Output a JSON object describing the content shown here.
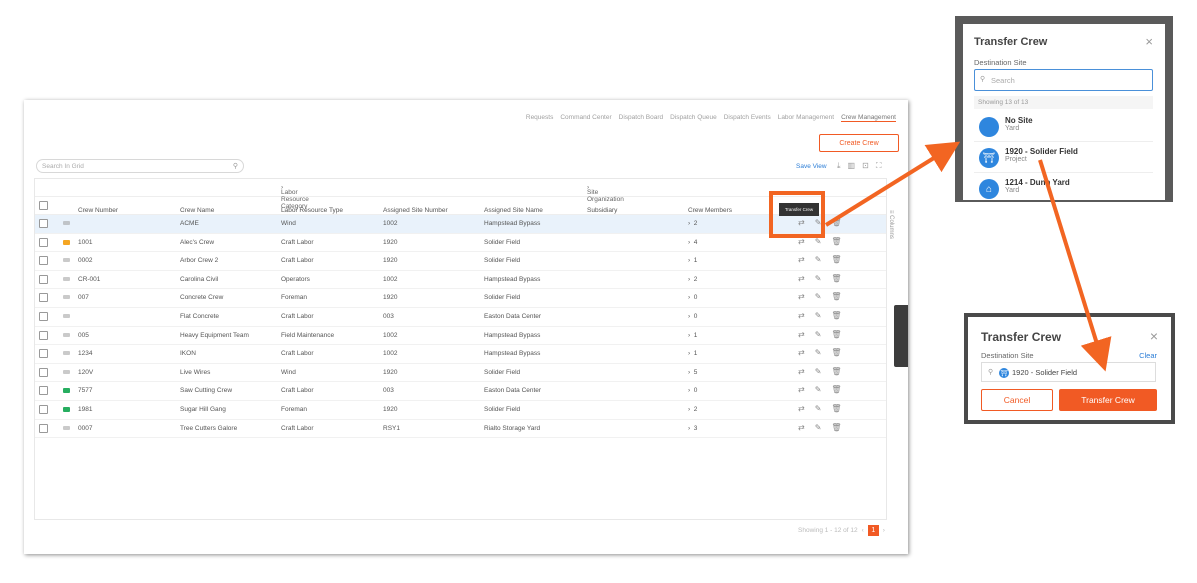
{
  "nav": {
    "items": [
      "Requests",
      "Command Center",
      "Dispatch Board",
      "Dispatch Queue",
      "Dispatch Events",
      "Labor Management",
      "Crew Management"
    ],
    "active_index": 6
  },
  "toolbar": {
    "create_label": "Create Crew",
    "search_placeholder": "Search In Grid",
    "save_view_label": "Save View"
  },
  "grid": {
    "group_headers": {
      "labor": "Labor Resource Category",
      "site": "Site Organization"
    },
    "columns": [
      "Crew Number",
      "Crew Name",
      "Labor Resource Type",
      "Assigned Site Number",
      "Assigned Site Name",
      "Subsidiary",
      "Crew Members"
    ],
    "rows": [
      {
        "number": "",
        "name": "ACME",
        "type": "Wind",
        "site_no": "1002",
        "site_name": "Hampstead Bypass",
        "members": "2",
        "tag": "grey"
      },
      {
        "number": "1001",
        "name": "Alec's Crew",
        "type": "Craft Labor",
        "site_no": "1920",
        "site_name": "Solider Field",
        "members": "4",
        "tag": "orange"
      },
      {
        "number": "0002",
        "name": "Arbor Crew 2",
        "type": "Craft Labor",
        "site_no": "1920",
        "site_name": "Solider Field",
        "members": "1",
        "tag": "grey"
      },
      {
        "number": "CR-001",
        "name": "Carolina Civil",
        "type": "Operators",
        "site_no": "1002",
        "site_name": "Hampstead Bypass",
        "members": "2",
        "tag": "grey"
      },
      {
        "number": "007",
        "name": "Concrete Crew",
        "type": "Foreman",
        "site_no": "1920",
        "site_name": "Solider Field",
        "members": "0",
        "tag": "grey"
      },
      {
        "number": "",
        "name": "Flat Concrete",
        "type": "Craft Labor",
        "site_no": "003",
        "site_name": "Easton Data Center",
        "members": "0",
        "tag": "grey"
      },
      {
        "number": "005",
        "name": "Heavy Equipment Team",
        "type": "Field Maintenance",
        "site_no": "1002",
        "site_name": "Hampstead Bypass",
        "members": "1",
        "tag": "grey"
      },
      {
        "number": "1234",
        "name": "IKON",
        "type": "Craft Labor",
        "site_no": "1002",
        "site_name": "Hampstead Bypass",
        "members": "1",
        "tag": "grey"
      },
      {
        "number": "120V",
        "name": "Live Wires",
        "type": "Wind",
        "site_no": "1920",
        "site_name": "Solider Field",
        "members": "5",
        "tag": "grey"
      },
      {
        "number": "7577",
        "name": "Saw Cutting Crew",
        "type": "Craft Labor",
        "site_no": "003",
        "site_name": "Easton Data Center",
        "members": "0",
        "tag": "green"
      },
      {
        "number": "1981",
        "name": "Sugar Hill Gang",
        "type": "Foreman",
        "site_no": "1920",
        "site_name": "Solider Field",
        "members": "2",
        "tag": "green"
      },
      {
        "number": "0007",
        "name": "Tree Cutters Galore",
        "type": "Craft Labor",
        "site_no": "RSY1",
        "site_name": "Rialto Storage Yard",
        "members": "3",
        "tag": "grey"
      }
    ],
    "side_label": "Columns",
    "footer_text": "Showing 1 - 12 of 12",
    "page": "1"
  },
  "tooltip": "Transfer Crew",
  "modal_search": {
    "title": "Transfer Crew",
    "label": "Destination Site",
    "placeholder": "Search",
    "showing": "Showing 13 of 13",
    "options": [
      {
        "name": "No Site",
        "sub": "Yard"
      },
      {
        "name": "1920 - Solider Field",
        "sub": "Project"
      },
      {
        "name": "1214 - Dunn Yard",
        "sub": "Yard"
      }
    ]
  },
  "modal_selected": {
    "title": "Transfer Crew",
    "label": "Destination Site",
    "clear": "Clear",
    "value": "1920 - Solider Field",
    "cancel": "Cancel",
    "submit": "Transfer Crew"
  },
  "colors": {
    "accent": "#f15a24",
    "link": "#2b7dd6",
    "site_icon": "#2e86de"
  }
}
